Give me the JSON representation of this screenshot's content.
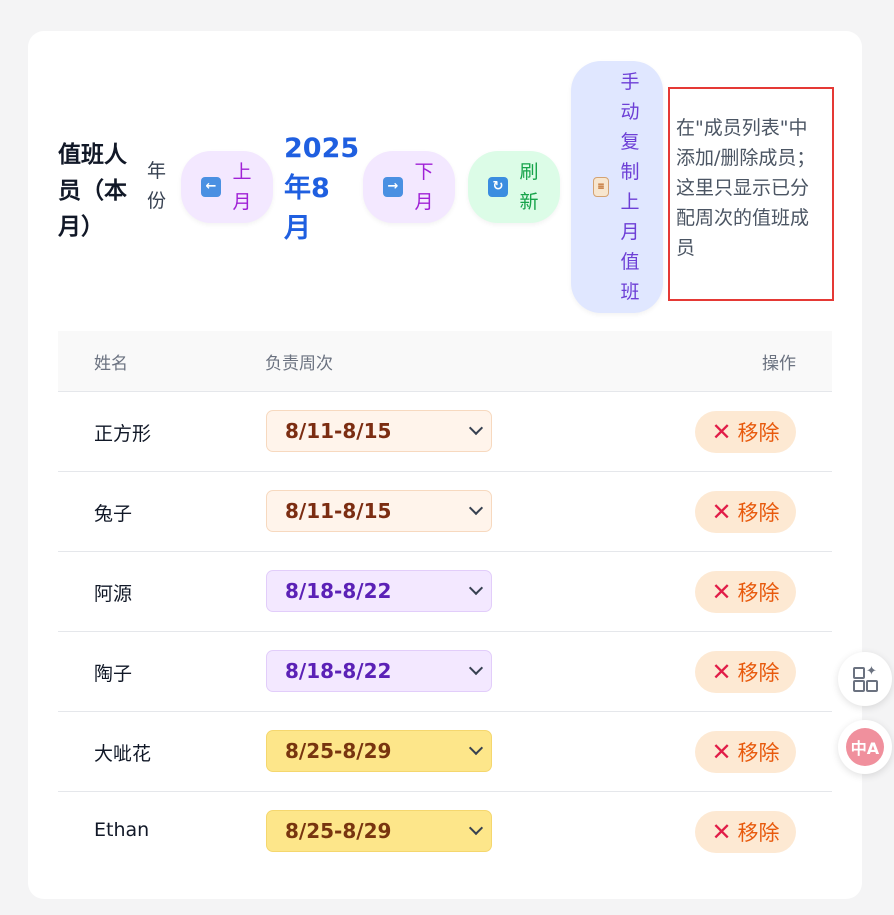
{
  "header": {
    "title": "值班人员（本月）",
    "year_label": "年份",
    "prev_label": "上月",
    "month_label": "2025年8月",
    "next_label": "下月",
    "refresh_label": "刷新",
    "copy_label": "手动复制上月值班",
    "note": "在\"成员列表\"中添加/删除成员；这里只显示已分配周次的值班成员"
  },
  "table": {
    "headers": {
      "name": "姓名",
      "week": "负责周次",
      "action": "操作"
    },
    "remove_label": "移除",
    "rows": [
      {
        "name": "正方形",
        "week": "8/11-8/15"
      },
      {
        "name": "兔子",
        "week": "8/11-8/15"
      },
      {
        "name": "阿源",
        "week": "8/18-8/22"
      },
      {
        "name": "陶子",
        "week": "8/18-8/22"
      },
      {
        "name": "大呲花",
        "week": "8/25-8/29"
      },
      {
        "name": "Ethan",
        "week": "8/25-8/29"
      }
    ]
  },
  "floating": {
    "translate_icon_text": "中A"
  },
  "colors": {
    "accent_blue": "#1f5fe0",
    "note_border": "#e53935",
    "remove_text": "#e8590c"
  },
  "icons": [
    "left-arrow-icon",
    "right-arrow-icon",
    "refresh-icon",
    "clipboard-icon",
    "close-icon",
    "chevron-down-icon",
    "apps-icon",
    "translate-icon"
  ]
}
